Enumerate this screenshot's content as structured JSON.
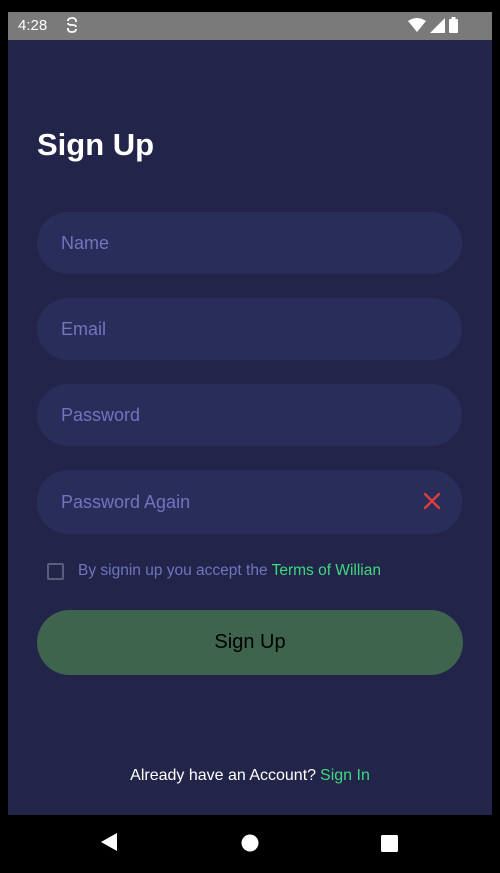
{
  "status_bar": {
    "time": "4:28",
    "icons": [
      "sync-icon",
      "wifi-icon",
      "signal-icon",
      "battery-icon"
    ]
  },
  "page": {
    "title": "Sign Up"
  },
  "form": {
    "name_placeholder": "Name",
    "email_placeholder": "Email",
    "password_placeholder": "Password",
    "password_again_placeholder": "Password Again",
    "clear_icon": "close-icon",
    "terms_text": "By signin up you accept the",
    "terms_link": "Terms of Willian",
    "terms_checked": false,
    "submit_label": "Sign Up"
  },
  "footer": {
    "text": "Already have an Account?",
    "link": "Sign In"
  },
  "nav": {
    "icons": [
      "back-icon",
      "home-icon",
      "recents-icon"
    ]
  },
  "colors": {
    "background": "#22244a",
    "field": "#292d5a",
    "placeholder": "#6f75bf",
    "accent_green": "#3ed97e",
    "button": "#3e644d",
    "error_red": "#e03c3c"
  }
}
